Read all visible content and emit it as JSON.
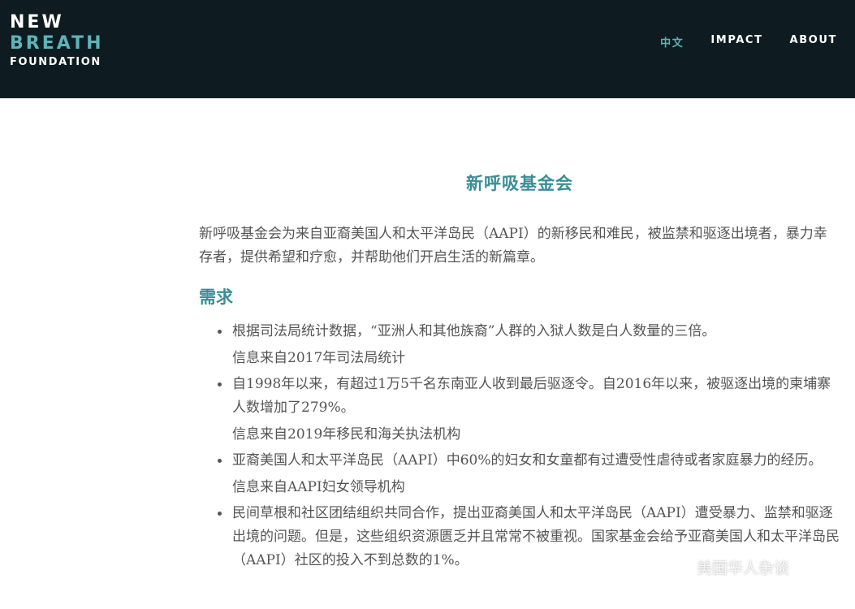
{
  "logo": {
    "line1": "NEW",
    "line2": "BREATH",
    "line3": "FOUNDATION"
  },
  "nav": {
    "items": [
      "中文",
      "IMPACT",
      "ABOUT"
    ]
  },
  "main": {
    "title": "新呼吸基金会",
    "intro": "新呼吸基金会为来自亚裔美国人和太平洋岛民（AAPI）的新移民和难民，被监禁和驱逐出境者，暴力幸存者，提供希望和疗愈，并帮助他们开启生活的新篇章。",
    "section_heading": "需求",
    "items": [
      {
        "text": "根据司法局统计数据，“亚洲人和其他族裔”人群的入狱人数是白人数量的三倍。",
        "source": "信息来自2017年司法局统计"
      },
      {
        "text": "自1998年以来，有超过1万5千名东南亚人收到最后驱逐令。自2016年以来，被驱逐出境的柬埔寨人数增加了279%。",
        "source": "信息来自2019年移民和海关执法机构"
      },
      {
        "text": "亚裔美国人和太平洋岛民（AAPI）中60%的妇女和女童都有过遭受性虐待或者家庭暴力的经历。",
        "source": "信息来自AAPI妇女领导机构"
      },
      {
        "text": "民间草根和社区团结组织共同合作，提出亚裔美国人和太平洋岛民（AAPI）遭受暴力、监禁和驱逐出境的问题。但是，这些组织资源匮乏并且常常不被重视。国家基金会给予亚裔美国人和太平洋岛民（AAPI）社区的投入不到总数的1%。"
      }
    ]
  },
  "watermark": {
    "text": "美国华人杂谈"
  }
}
